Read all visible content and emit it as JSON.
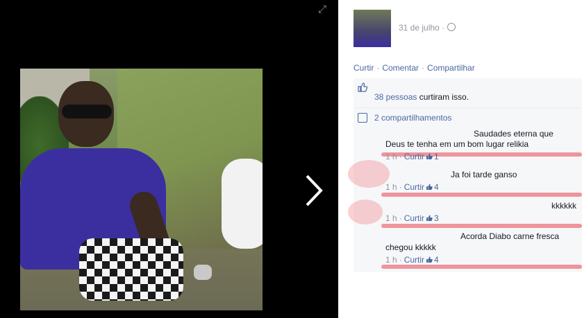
{
  "viewer": {
    "expand_icon": "expand-icon",
    "next_icon": "chevron-right-icon"
  },
  "post": {
    "date": "31 de julho ·",
    "actions": {
      "like": "Curtir",
      "comment": "Comentar",
      "share": "Compartilhar"
    },
    "likes_count": "38 pessoas",
    "likes_suffix": " curtiram isso.",
    "shares": "2 compartilhamentos"
  },
  "comments": [
    {
      "text_line1": "Saudades eterna que",
      "text_line2": "Deus te tenha em um bom lugar relikia",
      "time": "1 h",
      "like": "Curtir",
      "likes": "1"
    },
    {
      "text_line1": "Ja foi tarde ganso",
      "time": "1 h",
      "like": "Curtir",
      "likes": "4"
    },
    {
      "text_line1": "kkkkkk",
      "time": "1 h",
      "like": "Curtir",
      "likes": "3"
    },
    {
      "text_line1": "Acorda Diabo carne fresca",
      "text_line2": "chegou kkkkk",
      "time": "1 h",
      "like": "Curtir",
      "likes": "4"
    }
  ],
  "colors": {
    "link": "#4b67a1",
    "muted": "#90949c",
    "annotation": "#e64650"
  }
}
